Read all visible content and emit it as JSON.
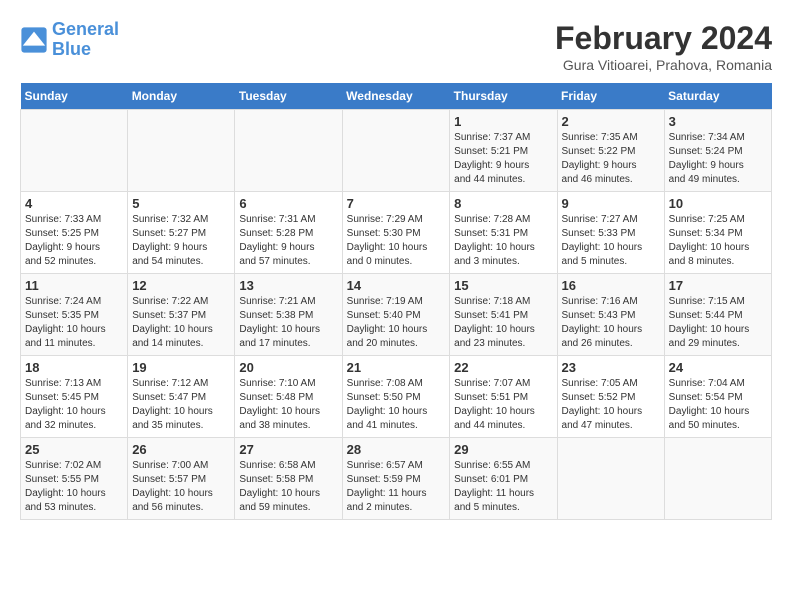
{
  "header": {
    "logo_line1": "General",
    "logo_line2": "Blue",
    "title": "February 2024",
    "subtitle": "Gura Vitioarei, Prahova, Romania"
  },
  "weekdays": [
    "Sunday",
    "Monday",
    "Tuesday",
    "Wednesday",
    "Thursday",
    "Friday",
    "Saturday"
  ],
  "weeks": [
    [
      {
        "day": "",
        "info": ""
      },
      {
        "day": "",
        "info": ""
      },
      {
        "day": "",
        "info": ""
      },
      {
        "day": "",
        "info": ""
      },
      {
        "day": "1",
        "info": "Sunrise: 7:37 AM\nSunset: 5:21 PM\nDaylight: 9 hours\nand 44 minutes."
      },
      {
        "day": "2",
        "info": "Sunrise: 7:35 AM\nSunset: 5:22 PM\nDaylight: 9 hours\nand 46 minutes."
      },
      {
        "day": "3",
        "info": "Sunrise: 7:34 AM\nSunset: 5:24 PM\nDaylight: 9 hours\nand 49 minutes."
      }
    ],
    [
      {
        "day": "4",
        "info": "Sunrise: 7:33 AM\nSunset: 5:25 PM\nDaylight: 9 hours\nand 52 minutes."
      },
      {
        "day": "5",
        "info": "Sunrise: 7:32 AM\nSunset: 5:27 PM\nDaylight: 9 hours\nand 54 minutes."
      },
      {
        "day": "6",
        "info": "Sunrise: 7:31 AM\nSunset: 5:28 PM\nDaylight: 9 hours\nand 57 minutes."
      },
      {
        "day": "7",
        "info": "Sunrise: 7:29 AM\nSunset: 5:30 PM\nDaylight: 10 hours\nand 0 minutes."
      },
      {
        "day": "8",
        "info": "Sunrise: 7:28 AM\nSunset: 5:31 PM\nDaylight: 10 hours\nand 3 minutes."
      },
      {
        "day": "9",
        "info": "Sunrise: 7:27 AM\nSunset: 5:33 PM\nDaylight: 10 hours\nand 5 minutes."
      },
      {
        "day": "10",
        "info": "Sunrise: 7:25 AM\nSunset: 5:34 PM\nDaylight: 10 hours\nand 8 minutes."
      }
    ],
    [
      {
        "day": "11",
        "info": "Sunrise: 7:24 AM\nSunset: 5:35 PM\nDaylight: 10 hours\nand 11 minutes."
      },
      {
        "day": "12",
        "info": "Sunrise: 7:22 AM\nSunset: 5:37 PM\nDaylight: 10 hours\nand 14 minutes."
      },
      {
        "day": "13",
        "info": "Sunrise: 7:21 AM\nSunset: 5:38 PM\nDaylight: 10 hours\nand 17 minutes."
      },
      {
        "day": "14",
        "info": "Sunrise: 7:19 AM\nSunset: 5:40 PM\nDaylight: 10 hours\nand 20 minutes."
      },
      {
        "day": "15",
        "info": "Sunrise: 7:18 AM\nSunset: 5:41 PM\nDaylight: 10 hours\nand 23 minutes."
      },
      {
        "day": "16",
        "info": "Sunrise: 7:16 AM\nSunset: 5:43 PM\nDaylight: 10 hours\nand 26 minutes."
      },
      {
        "day": "17",
        "info": "Sunrise: 7:15 AM\nSunset: 5:44 PM\nDaylight: 10 hours\nand 29 minutes."
      }
    ],
    [
      {
        "day": "18",
        "info": "Sunrise: 7:13 AM\nSunset: 5:45 PM\nDaylight: 10 hours\nand 32 minutes."
      },
      {
        "day": "19",
        "info": "Sunrise: 7:12 AM\nSunset: 5:47 PM\nDaylight: 10 hours\nand 35 minutes."
      },
      {
        "day": "20",
        "info": "Sunrise: 7:10 AM\nSunset: 5:48 PM\nDaylight: 10 hours\nand 38 minutes."
      },
      {
        "day": "21",
        "info": "Sunrise: 7:08 AM\nSunset: 5:50 PM\nDaylight: 10 hours\nand 41 minutes."
      },
      {
        "day": "22",
        "info": "Sunrise: 7:07 AM\nSunset: 5:51 PM\nDaylight: 10 hours\nand 44 minutes."
      },
      {
        "day": "23",
        "info": "Sunrise: 7:05 AM\nSunset: 5:52 PM\nDaylight: 10 hours\nand 47 minutes."
      },
      {
        "day": "24",
        "info": "Sunrise: 7:04 AM\nSunset: 5:54 PM\nDaylight: 10 hours\nand 50 minutes."
      }
    ],
    [
      {
        "day": "25",
        "info": "Sunrise: 7:02 AM\nSunset: 5:55 PM\nDaylight: 10 hours\nand 53 minutes."
      },
      {
        "day": "26",
        "info": "Sunrise: 7:00 AM\nSunset: 5:57 PM\nDaylight: 10 hours\nand 56 minutes."
      },
      {
        "day": "27",
        "info": "Sunrise: 6:58 AM\nSunset: 5:58 PM\nDaylight: 10 hours\nand 59 minutes."
      },
      {
        "day": "28",
        "info": "Sunrise: 6:57 AM\nSunset: 5:59 PM\nDaylight: 11 hours\nand 2 minutes."
      },
      {
        "day": "29",
        "info": "Sunrise: 6:55 AM\nSunset: 6:01 PM\nDaylight: 11 hours\nand 5 minutes."
      },
      {
        "day": "",
        "info": ""
      },
      {
        "day": "",
        "info": ""
      }
    ]
  ]
}
